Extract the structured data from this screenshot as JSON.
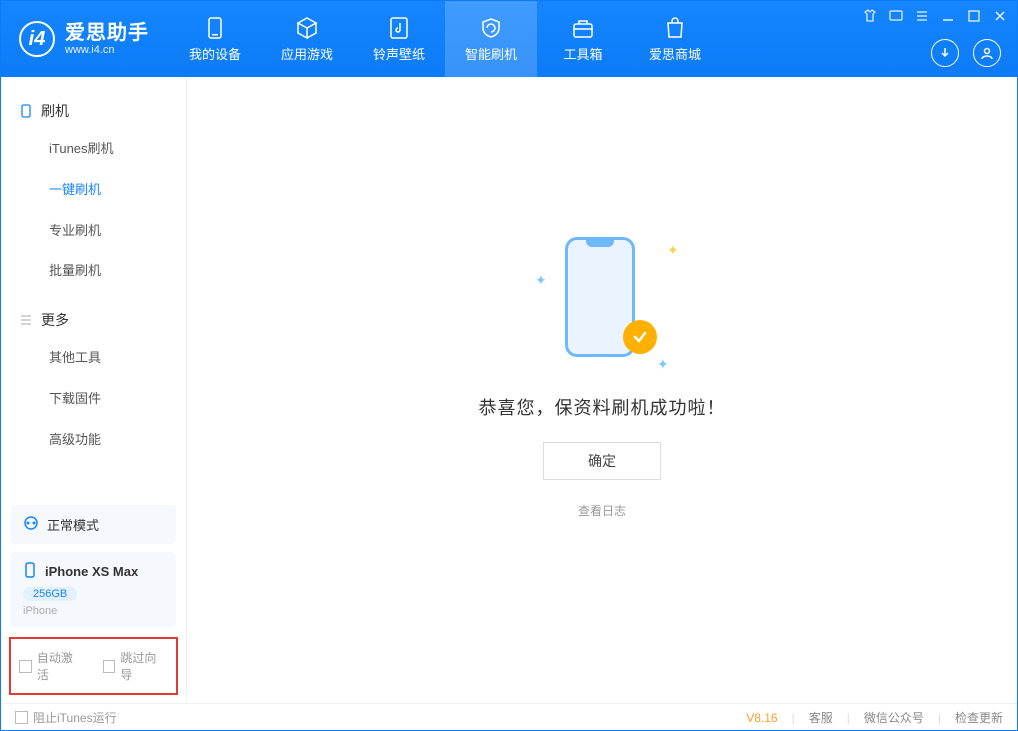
{
  "app": {
    "title": "爱思助手",
    "subtitle": "www.i4.cn"
  },
  "tabs": [
    {
      "label": "我的设备"
    },
    {
      "label": "应用游戏"
    },
    {
      "label": "铃声壁纸"
    },
    {
      "label": "智能刷机"
    },
    {
      "label": "工具箱"
    },
    {
      "label": "爱思商城"
    }
  ],
  "sidebar": {
    "section1": {
      "title": "刷机",
      "items": [
        "iTunes刷机",
        "一键刷机",
        "专业刷机",
        "批量刷机"
      ]
    },
    "section2": {
      "title": "更多",
      "items": [
        "其他工具",
        "下载固件",
        "高级功能"
      ]
    }
  },
  "device_mode": {
    "label": "正常模式"
  },
  "device": {
    "name": "iPhone XS Max",
    "storage": "256GB",
    "type": "iPhone"
  },
  "options": {
    "auto_activate": "自动激活",
    "skip_guide": "跳过向导"
  },
  "main": {
    "success_text": "恭喜您，保资料刷机成功啦！",
    "ok_button": "确定",
    "view_log": "查看日志"
  },
  "footer": {
    "block_itunes": "阻止iTunes运行",
    "version": "V8.16",
    "support": "客服",
    "wechat": "微信公众号",
    "check_update": "检查更新"
  }
}
